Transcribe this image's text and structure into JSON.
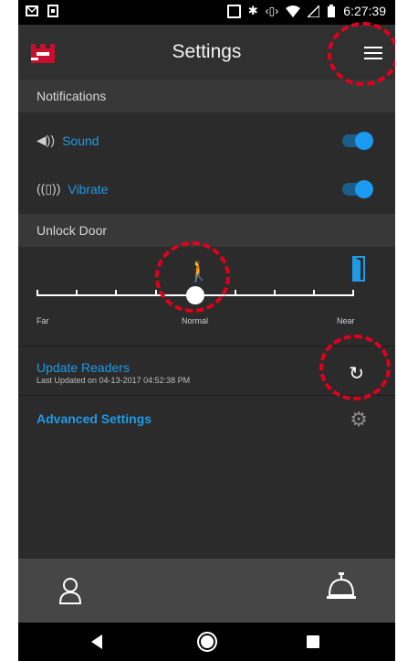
{
  "status_bar": {
    "time": "6:27:39"
  },
  "app_bar": {
    "title": "Settings",
    "logo_icon": "castle-logo-icon",
    "menu_icon": "hamburger-menu-icon"
  },
  "notifications": {
    "header": "Notifications",
    "sound": {
      "label": "Sound",
      "icon": "speaker-icon",
      "enabled": true
    },
    "vibrate": {
      "label": "Vibrate",
      "icon": "vibrate-icon",
      "enabled": true
    }
  },
  "unlock_door": {
    "header": "Unlock Door",
    "range_labels": {
      "far": "Far",
      "normal": "Normal",
      "near": "Near"
    },
    "position_percent": 50,
    "walker_icon": "walking-person-icon",
    "door_icon": "door-icon"
  },
  "update_readers": {
    "title": "Update Readers",
    "last_updated": "Last Updated on 04-13-2017 04:52:38 PM",
    "refresh_icon": "refresh-icon"
  },
  "advanced": {
    "title": "Advanced Settings",
    "gear_icon": "gear-icon"
  },
  "bottom_nav": {
    "profile_icon": "person-icon",
    "bell_icon": "service-bell-icon"
  },
  "colors": {
    "accent": "#1f9be6",
    "background": "#2b2b2b",
    "annotation": "#e0001b"
  }
}
